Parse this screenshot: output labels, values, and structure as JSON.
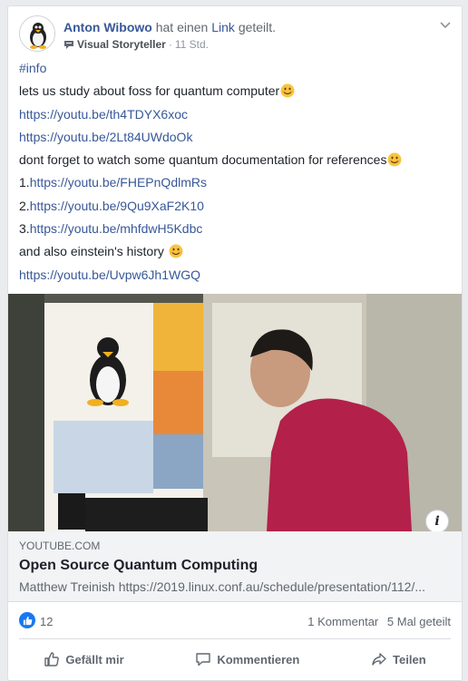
{
  "post": {
    "author": "Anton Wibowo",
    "action_pre": "hat einen",
    "action_link": "Link",
    "action_post": "geteilt.",
    "group": "Visual Storyteller",
    "separator": "·",
    "time": "11 Std.",
    "menu_icon": "chevron-down-icon",
    "lines": {
      "hashtag": "#info",
      "l2": "lets us study about foss for quantum computer",
      "u1": "https://youtu.be/th4TDYX6xoc",
      "u2": "https://youtu.be/2Lt84UWdoOk",
      "l5": "dont forget to watch some quantum documentation for references",
      "n1": "1.",
      "u3": "https://youtu.be/FHEPnQdlmRs",
      "n2": "2.",
      "u4": "https://youtu.be/9Qu9XaF2K10",
      "n3": "3.",
      "u5": "https://youtu.be/mhfdwH5Kdbc",
      "l9": "and also einstein's history",
      "u6": "https://youtu.be/Uvpw6Jh1WGQ"
    }
  },
  "link_preview": {
    "domain": "YOUTUBE.COM",
    "title": "Open Source Quantum Computing",
    "description": "Matthew Treinish https://2019.linux.conf.au/schedule/presentation/112/...",
    "info_label": "i"
  },
  "stats": {
    "likes": "12",
    "comments": "1 Kommentar",
    "shares": "5 Mal geteilt"
  },
  "actions": {
    "like": "Gefällt mir",
    "comment": "Kommentieren",
    "share": "Teilen"
  },
  "colors": {
    "link": "#385898",
    "like_blue": "#1877f2",
    "background": "#e9ebee"
  }
}
